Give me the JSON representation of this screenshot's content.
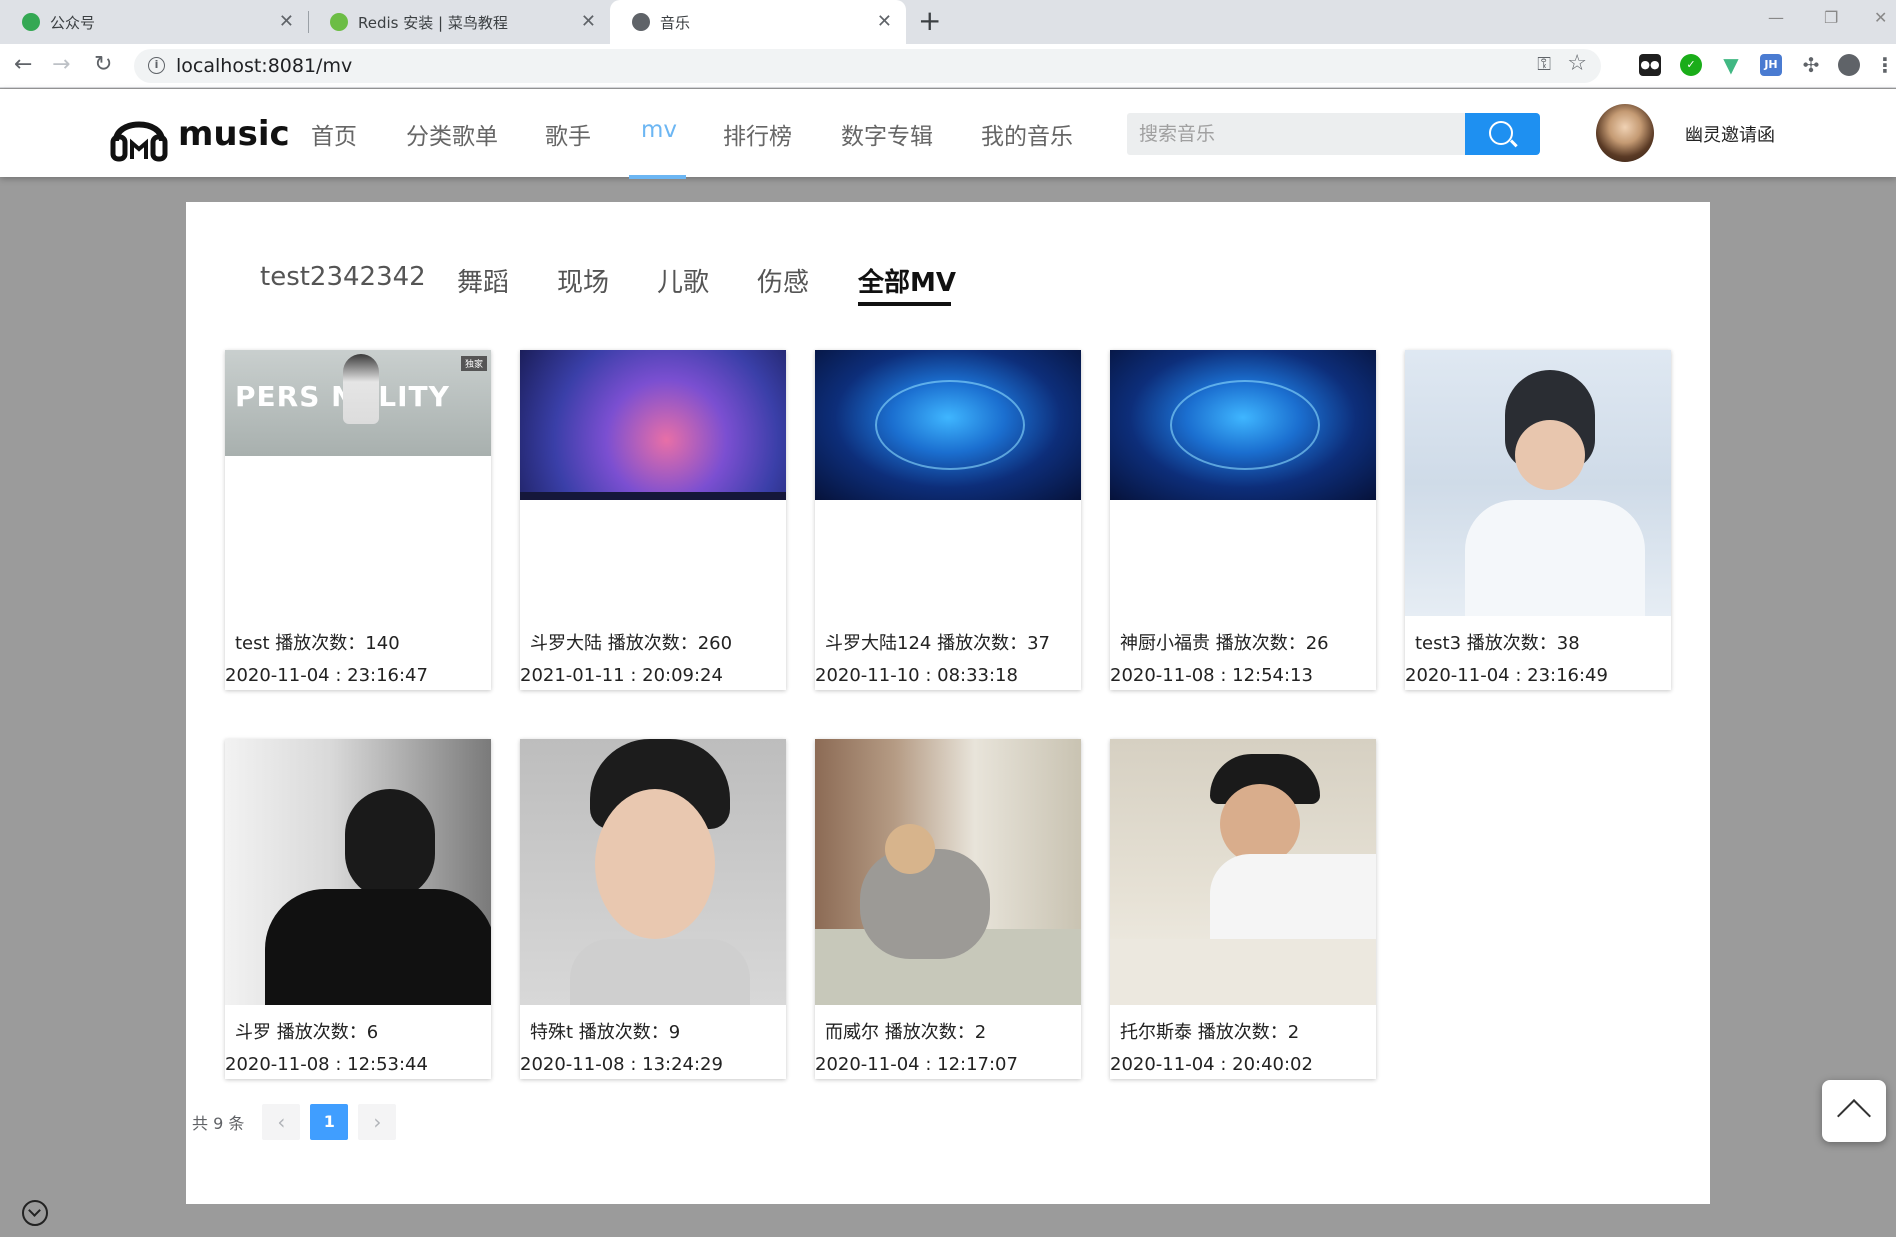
{
  "browser": {
    "tabs": [
      {
        "title": "公众号",
        "favicon_color": "#34a853"
      },
      {
        "title": "Redis 安装 | 菜鸟教程",
        "favicon_color": "#6cbd45"
      },
      {
        "title": "音乐",
        "favicon_color": "#5f6368"
      }
    ],
    "url": "localhost:8081/mv",
    "extensions": [
      {
        "name": "tampermonkey-icon",
        "color": "#1f1f1f",
        "label": ""
      },
      {
        "name": "vpn-icon",
        "color": "#1aad19",
        "label": ""
      },
      {
        "name": "vue-devtools-icon",
        "color": "#41b883",
        "label": ""
      },
      {
        "name": "jh-icon",
        "color": "#4a7bd1",
        "label": "JH"
      }
    ]
  },
  "header": {
    "logo_text": "music",
    "nav": [
      {
        "label": "首页"
      },
      {
        "label": "分类歌单"
      },
      {
        "label": "歌手"
      },
      {
        "label": "mv"
      },
      {
        "label": "排行榜"
      },
      {
        "label": "数字专辑"
      },
      {
        "label": "我的音乐"
      }
    ],
    "active_nav": "mv",
    "search_placeholder": "搜索音乐",
    "user_name": "幽灵邀请函",
    "accent_color": "#6cb6f3",
    "search_color": "#1e90f1"
  },
  "categories": {
    "items": [
      {
        "label": "test2342342"
      },
      {
        "label": "舞蹈"
      },
      {
        "label": "现场"
      },
      {
        "label": "儿歌"
      },
      {
        "label": "伤感"
      },
      {
        "label": "全部MV"
      }
    ],
    "active": "全部MV"
  },
  "mvs": [
    {
      "title": "test 播放次数：140",
      "date": "2020-11-04 : 23:16:47"
    },
    {
      "title": "斗罗大陆 播放次数：260",
      "date": "2021-01-11 : 20:09:24"
    },
    {
      "title": "斗罗大陆124 播放次数：37",
      "date": "2020-11-10 : 08:33:18"
    },
    {
      "title": "神厨小福贵 播放次数：26",
      "date": "2020-11-08 : 12:54:13"
    },
    {
      "title": "test3 播放次数：38",
      "date": "2020-11-04 : 23:16:49"
    },
    {
      "title": "斗罗 播放次数：6",
      "date": "2020-11-08 : 12:53:44"
    },
    {
      "title": "特殊t 播放次数：9",
      "date": "2020-11-08 : 13:24:29"
    },
    {
      "title": "而威尔 播放次数：2",
      "date": "2020-11-04 : 12:17:07"
    },
    {
      "title": "托尔斯泰 播放次数：2",
      "date": "2020-11-04 : 20:40:02"
    }
  ],
  "thumb_overlay": {
    "banner_text": "PERS NALITY",
    "exclusive_badge": "独家"
  },
  "pagination": {
    "total_text": "共 9 条",
    "current_page": "1",
    "prev": "‹",
    "next": "›"
  }
}
